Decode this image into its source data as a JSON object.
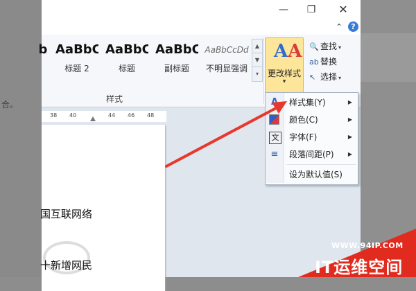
{
  "background": {
    "left_text": "合。"
  },
  "window": {
    "minimize_glyph": "—",
    "maximize_glyph": "❐",
    "close_glyph": "✕",
    "help_glyph": "?",
    "collapse_glyph": "⌃"
  },
  "ribbon": {
    "styles": [
      {
        "sample": "b",
        "name": ""
      },
      {
        "sample": "AaBbC",
        "name": "标题 2"
      },
      {
        "sample": "AaBbC",
        "name": "标题"
      },
      {
        "sample": "AaBbC",
        "name": "副标题"
      },
      {
        "sample": "AaBbCcDd",
        "name": "不明显强调"
      }
    ],
    "group_label": "样式",
    "change_style_label": "更改样式",
    "change_style_arrow": "▾",
    "edit": {
      "find": "查找",
      "replace": "替换",
      "select": "选择"
    }
  },
  "ruler": {
    "ticks": [
      "38",
      "40",
      "44",
      "46",
      "48"
    ]
  },
  "document": {
    "lines": [
      "国互联网络",
      "十新增网民"
    ]
  },
  "menu": {
    "items": [
      {
        "label": "样式集(Y)",
        "has_submenu": true,
        "icon": "style-set-icon"
      },
      {
        "label": "颜色(C)",
        "has_submenu": true,
        "icon": "colors-icon"
      },
      {
        "label": "字体(F)",
        "has_submenu": true,
        "icon": "fonts-icon"
      },
      {
        "label": "段落间距(P)",
        "has_submenu": true,
        "icon": "paragraph-spacing-icon"
      },
      {
        "label": "设为默认值(S)",
        "has_submenu": false,
        "icon": ""
      }
    ],
    "submenu_arrow": "▶"
  },
  "annotation": {
    "arrow_color": "#e8372b"
  },
  "watermark": {
    "url": "WWW.94IP.COM",
    "name": "IT运维空间"
  }
}
